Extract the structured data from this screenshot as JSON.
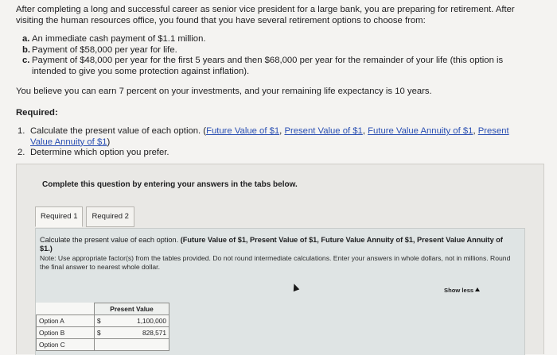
{
  "intro": "After completing a long and successful career as senior vice president for a large bank, you are preparing for retirement. After visiting the human resources office, you found that you have several retirement options to choose from:",
  "options": [
    {
      "letter": "a.",
      "text": "An immediate cash payment of $1.1 million."
    },
    {
      "letter": "b.",
      "text": "Payment of $58,000 per year for life."
    },
    {
      "letter": "c.",
      "text": "Payment of $48,000 per year for the first 5 years and then $68,000 per year for the remainder of your life (this option is intended to give you some protection against inflation)."
    }
  ],
  "life_text": "You believe you can earn 7 percent on your investments, and your remaining life expectancy is 10 years.",
  "required_label": "Required:",
  "requirements": {
    "r1_num": "1.",
    "r1_text": "Calculate the present value of each option. (",
    "links": [
      "Future Value of $1",
      "Present Value of $1",
      "Future Value Annuity of $1",
      "Present Value Annuity of $1"
    ],
    "sep": ", ",
    "close": ")",
    "r2_num": "2.",
    "r2_text": "Determine which option you prefer."
  },
  "panel": {
    "heading": "Complete this question by entering your answers in the tabs below.",
    "tabs": [
      "Required 1",
      "Required 2"
    ],
    "instruction_plain": "Calculate the present value of each option. ",
    "instruction_bold": "(Future Value of $1, Present Value of $1, Future Value Annuity of $1, Present Value Annuity of $1.)",
    "note": "Note: Use appropriate factor(s) from the tables provided. Do not round intermediate calculations. Enter your answers in whole dollars, not in millions. Round the final answer to nearest whole dollar.",
    "show_less": "Show less"
  },
  "table": {
    "header": "Present Value",
    "rows": [
      {
        "label": "Option A",
        "currency": "$",
        "value": "1,100,000"
      },
      {
        "label": "Option B",
        "currency": "$",
        "value": "828,571"
      },
      {
        "label": "Option C",
        "currency": "",
        "value": ""
      }
    ]
  }
}
